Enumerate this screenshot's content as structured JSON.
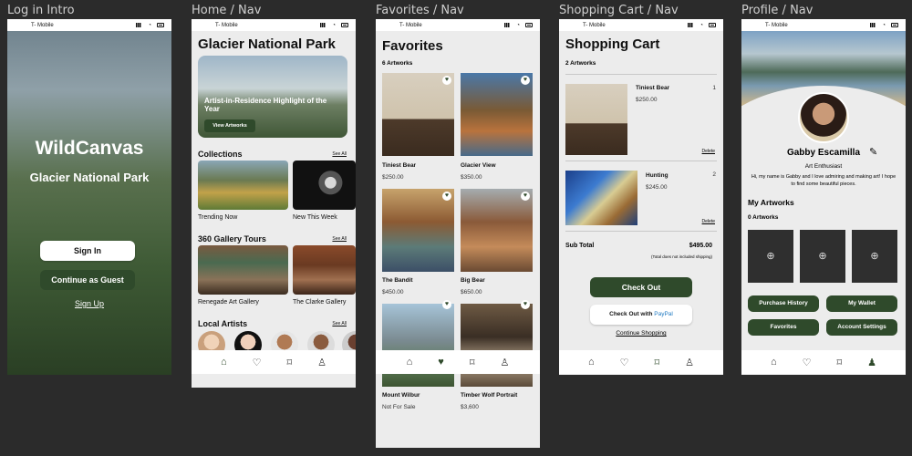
{
  "frames": {
    "login": "Log in Intro",
    "home": "Home / Nav",
    "favorites": "Favorites / Nav",
    "cart": "Shopping Cart / Nav",
    "profile": "Profile / Nav"
  },
  "status": {
    "carrier": "T- Mobile"
  },
  "colors": {
    "accent": "#2f4a2b",
    "bg": "#ececec",
    "canvas": "#2b2b2b"
  },
  "login": {
    "title": "WildCanvas",
    "subtitle": "Glacier National Park",
    "sign_in": "Sign In",
    "guest": "Continue as Guest",
    "sign_up": "Sign Up"
  },
  "home": {
    "title": "Glacier National Park",
    "hero_text": "Artist-in-Residence Highlight of the Year",
    "hero_button": "View Artworks",
    "collections": "Collections",
    "see_all": "See All",
    "collection_items": [
      "Trending Now",
      "New This Week"
    ],
    "tours": "360 Gallery Tours",
    "tour_items": [
      "Renegade Art Gallery",
      "The Clarke Gallery"
    ],
    "artists": "Local Artists"
  },
  "favorites": {
    "title": "Favorites",
    "count": "6 Artworks",
    "items": [
      {
        "name": "Tiniest Bear",
        "price": "$250.00"
      },
      {
        "name": "Glacier View",
        "price": "$350.00"
      },
      {
        "name": "The Bandit",
        "price": "$450.00"
      },
      {
        "name": "Big Bear",
        "price": "$650.00"
      },
      {
        "name": "Mount Wilbur",
        "price": "Not For Sale"
      },
      {
        "name": "Timber Wolf Portrait",
        "price": "$3,600"
      }
    ]
  },
  "cart": {
    "title": "Shopping Cart",
    "count": "2 Artworks",
    "items": [
      {
        "name": "Tiniest Bear",
        "price": "$250.00",
        "qty": "1",
        "delete": "Delete"
      },
      {
        "name": "Hunting",
        "price": "$245.00",
        "qty": "2",
        "delete": "Delete"
      }
    ],
    "subtotal_label": "Sub Total",
    "subtotal_value": "$495.00",
    "shipping_note": "(Total does not included shipping)",
    "checkout": "Check Out",
    "paypal_prefix": "Check Out with",
    "paypal": "PayPal",
    "continue": "Continue Shopping"
  },
  "profile": {
    "name": "Gabby Escamilla",
    "role": "Art Enthusiast",
    "bio": "Hi, my name is Gabby and I love admiring and making art! I hope to find some beautiful pieces.",
    "my_artworks": "My Artworks",
    "count": "0 Artworks",
    "buttons": [
      "Purchase History",
      "My Wallet",
      "Favorites",
      "Account Settings"
    ]
  }
}
